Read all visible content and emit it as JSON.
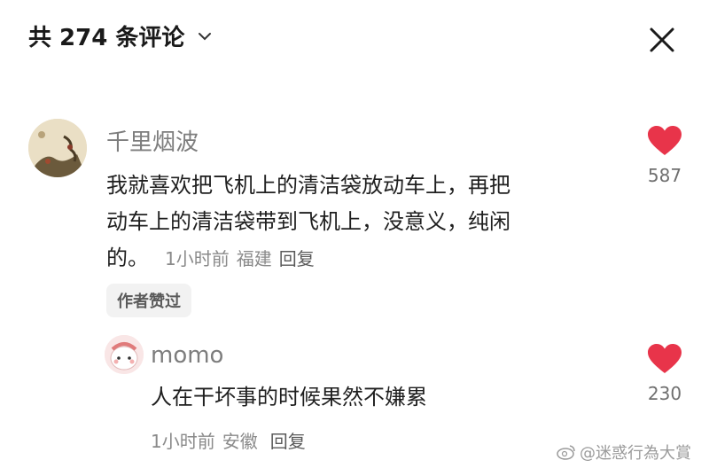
{
  "header": {
    "title": "共 274 条评论",
    "chevron_icon": "chevron-down-icon",
    "close_icon": "close-icon"
  },
  "comments": [
    {
      "username": "千里烟波",
      "text_line1": "我就喜欢把飞机上的清洁袋放动车上，再把",
      "text_line2": "动车上的清洁袋带到飞机上，没意义，纯闲",
      "text_line3": "的。",
      "time": "1小时前",
      "location": "福建",
      "reply_label": "回复",
      "likes": "587",
      "badge": "作者赞过"
    },
    {
      "username": "momo",
      "text": "人在干坏事的时候果然不嫌累",
      "time": "1小时前",
      "location": "安徽",
      "reply_label": "回复",
      "likes": "230"
    }
  ],
  "watermark": "@迷惑行為大賞",
  "colors": {
    "heart": "#e8344a",
    "username": "#7d7d7d",
    "meta": "#8a8a8a"
  }
}
